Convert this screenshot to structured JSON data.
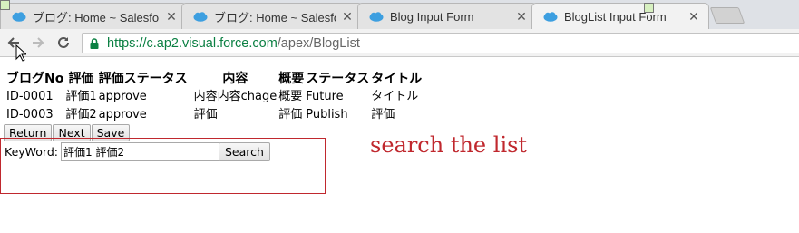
{
  "browser": {
    "tabs": [
      {
        "title": "ブログ: Home ~ Salesfo",
        "icon": "salesforce-cloud-icon",
        "active": false
      },
      {
        "title": "ブログ: Home ~ Salesfo",
        "icon": "salesforce-cloud-icon",
        "active": false
      },
      {
        "title": "Blog Input Form",
        "icon": "salesforce-cloud-icon",
        "active": false
      },
      {
        "title": "BlogList Input Form",
        "icon": "salesforce-cloud-icon",
        "active": true
      }
    ],
    "close_glyph": "✕",
    "url": {
      "base": "https://c.ap2.visual.force.com",
      "path": "/apex/BlogList"
    },
    "colors": {
      "secure_url": "#0b8043",
      "favicon": "#3d9fe0"
    }
  },
  "bloglist": {
    "columns": [
      "ブログNo",
      "評価",
      "評価ステータス",
      "内容",
      "概要",
      "ステータス",
      "タイトル"
    ],
    "rows": [
      [
        "ID-0001",
        "評価1",
        "approve",
        "内容内容chage",
        "概要",
        "Future",
        "タイトル"
      ],
      [
        "ID-0003",
        "評価2",
        "approve",
        "評価",
        "評価",
        "Publish",
        "評価"
      ]
    ]
  },
  "actions": {
    "return_label": "Return",
    "next_label": "Next",
    "save_label": "Save"
  },
  "search": {
    "label": "KeyWord:",
    "value": "評価1 評価2",
    "button_label": "Search"
  },
  "annotation": {
    "text": "search the list",
    "color": "#c0282e"
  }
}
